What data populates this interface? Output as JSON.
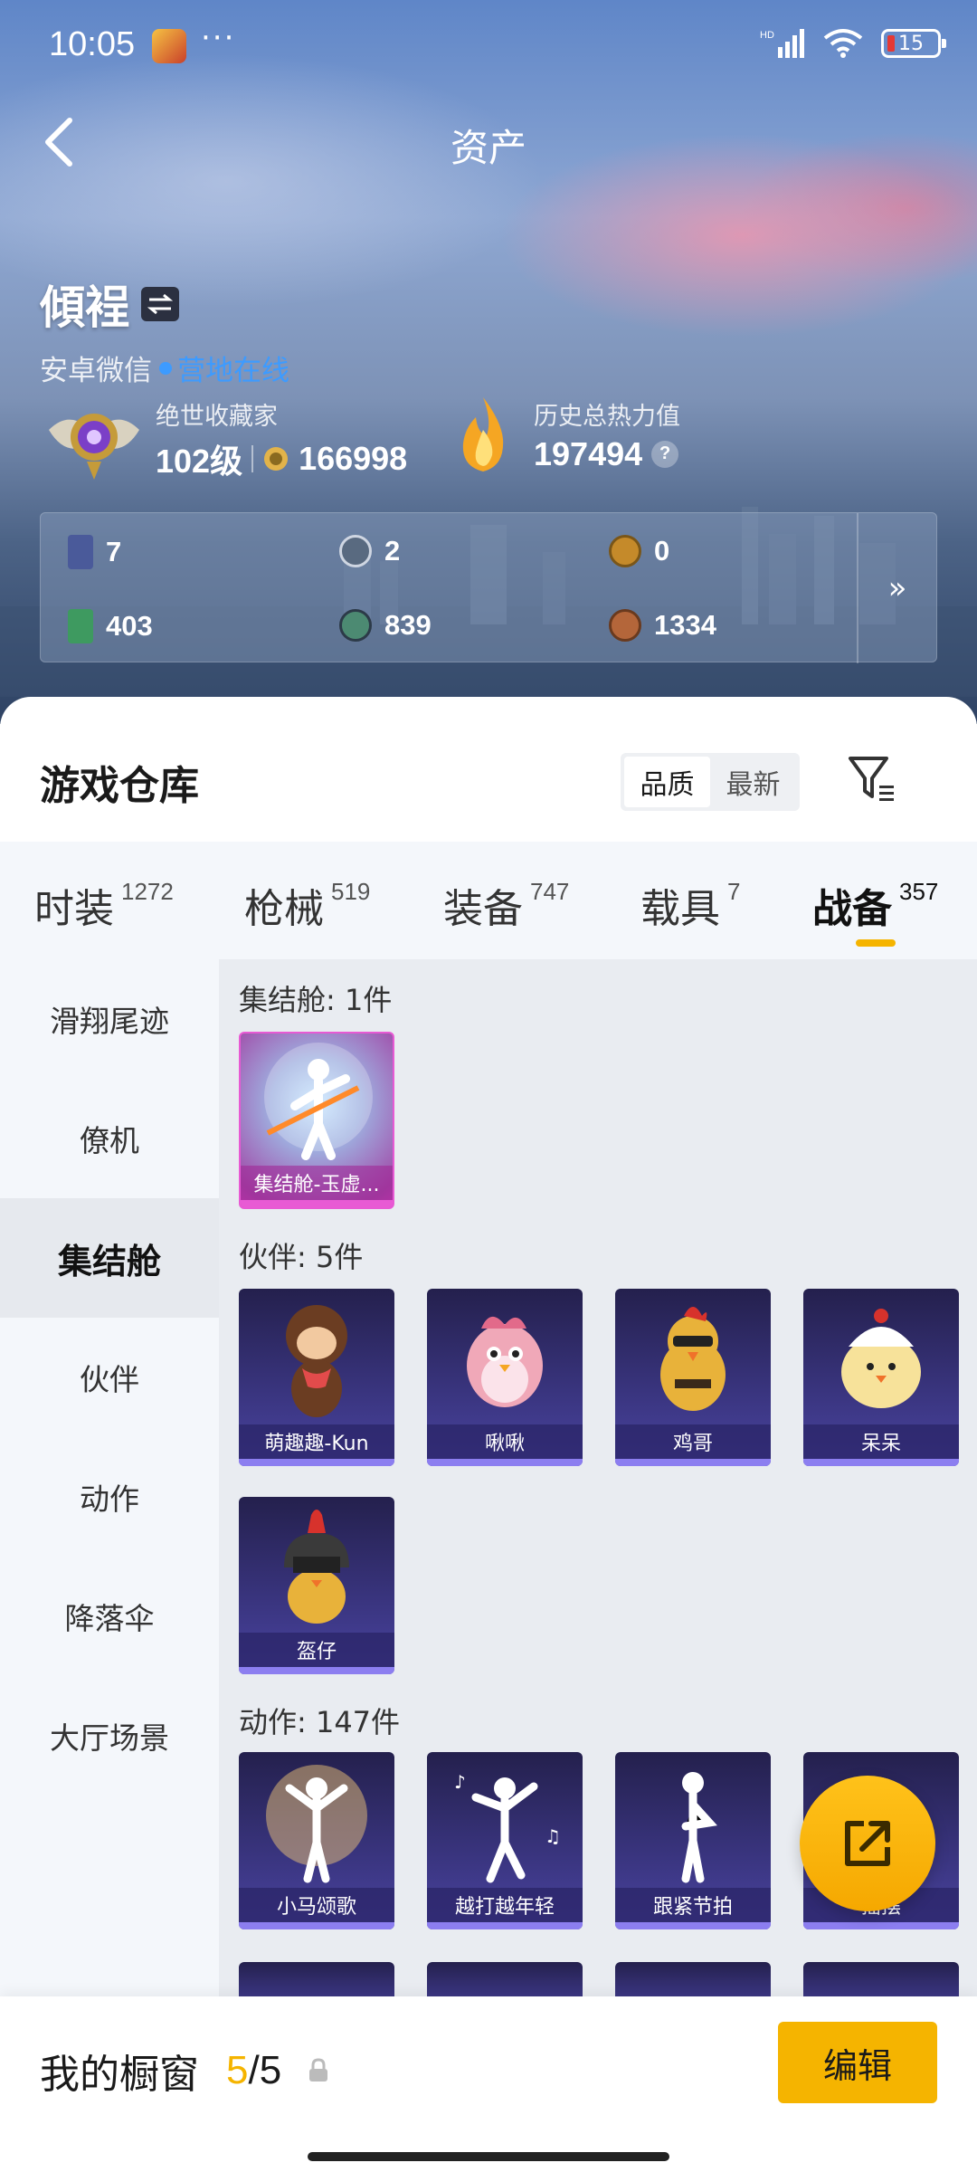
{
  "status_bar": {
    "time": "10:05",
    "dots": "···",
    "battery": "15"
  },
  "header": {
    "title": "资产"
  },
  "profile": {
    "name": "傾裎",
    "platform": "安卓微信",
    "online_status": "营地在线"
  },
  "stats": {
    "rank_label": "绝世收藏家",
    "level": "102级",
    "coins": "166998",
    "heat_label": "历史总热力值",
    "heat_value": "197494",
    "help": "?"
  },
  "currencies": [
    {
      "value": "7",
      "icon": "card-icon",
      "color": "#4a5a9a"
    },
    {
      "value": "2",
      "icon": "token-icon",
      "color": "#596a80"
    },
    {
      "value": "0",
      "icon": "gold-token-icon",
      "color": "#c58a2a"
    },
    {
      "value": "403",
      "icon": "ticket-icon",
      "color": "#3e9a60"
    },
    {
      "value": "839",
      "icon": "gem-icon",
      "color": "#4c8a72"
    },
    {
      "value": "1334",
      "icon": "bronze-coin-icon",
      "color": "#b4663a"
    }
  ],
  "currency_more": "»",
  "warehouse": {
    "title": "游戏仓库",
    "sort_options": [
      "品质",
      "最新"
    ]
  },
  "tabs": [
    {
      "name": "时装",
      "count": "1272"
    },
    {
      "name": "枪械",
      "count": "519"
    },
    {
      "name": "装备",
      "count": "747"
    },
    {
      "name": "载具",
      "count": "7"
    },
    {
      "name": "战备",
      "count": "357"
    }
  ],
  "sidebar": [
    "滑翔尾迹",
    "僚机",
    "集结舱",
    "伙伴",
    "动作",
    "降落伞",
    "大厅场景"
  ],
  "sections": {
    "pod_label": "集结舱: 1件",
    "pod_items": [
      "集结舱-玉虚..."
    ],
    "partner_label": "伙伴: 5件",
    "partner_items": [
      "萌趣趣-Kun",
      "啾啾",
      "鸡哥",
      "呆呆",
      "盔仔"
    ],
    "action_label": "动作: 147件",
    "action_items": [
      "小马颂歌",
      "越打越年轻",
      "跟紧节拍",
      "摇摆"
    ]
  },
  "bottom": {
    "window_label": "我的橱窗",
    "current": "5",
    "separator": "/",
    "total": "5",
    "edit": "编辑"
  },
  "colors": {
    "accent": "#f5b400",
    "online": "#3d9bff",
    "card_purple": "#3a3580",
    "card_pink": "#e85ad4"
  }
}
